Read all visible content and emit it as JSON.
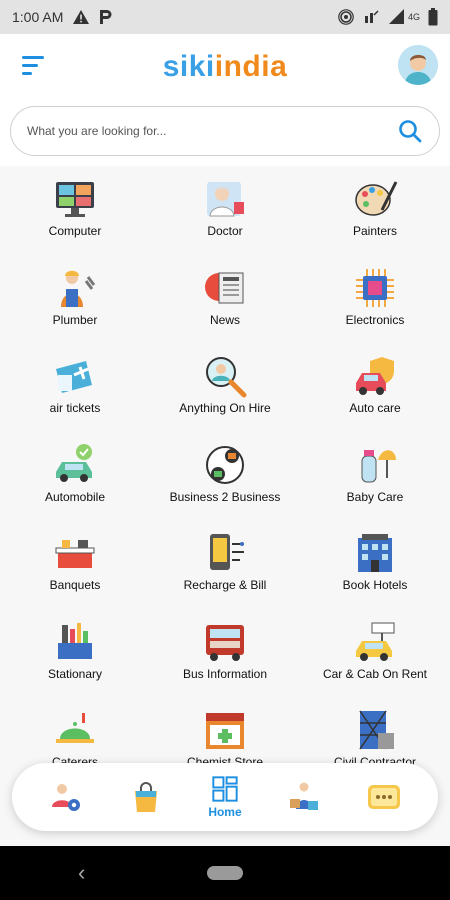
{
  "status_bar": {
    "time": "1:00 AM",
    "notification_icons": [
      "warning-icon",
      "parking-icon"
    ],
    "system_icons": [
      "hotspot-icon",
      "data-saver-icon",
      "signal-icon",
      "lte-icon",
      "battery-icon"
    ],
    "network_label": "4G"
  },
  "header": {
    "logo_part1": "siki",
    "logo_part2": "india",
    "logo_color1": "#3aa0e6",
    "logo_color2": "#f08a1c",
    "menu_icon": "menu-icon",
    "avatar_icon": "user-avatar-icon"
  },
  "search": {
    "placeholder": "What you are looking for...",
    "icon": "search-icon",
    "accent": "#1e8fe0"
  },
  "categories": [
    {
      "label": "Computer",
      "icon": "computer-icon"
    },
    {
      "label": "Doctor",
      "icon": "doctor-icon"
    },
    {
      "label": "Painters",
      "icon": "palette-icon"
    },
    {
      "label": "Plumber",
      "icon": "plumber-icon"
    },
    {
      "label": "News",
      "icon": "newspaper-icon"
    },
    {
      "label": "Electronics",
      "icon": "chip-icon"
    },
    {
      "label": "air tickets",
      "icon": "airplane-ticket-icon"
    },
    {
      "label": "Anything On Hire",
      "icon": "magnifier-person-icon"
    },
    {
      "label": "Auto care",
      "icon": "car-shield-icon"
    },
    {
      "label": "Automobile",
      "icon": "car-check-icon"
    },
    {
      "label": "Business 2 Business",
      "icon": "b2b-exchange-icon"
    },
    {
      "label": "Baby Care",
      "icon": "baby-bottle-icon"
    },
    {
      "label": "Banquets",
      "icon": "banquet-table-icon"
    },
    {
      "label": "Recharge & Bill",
      "icon": "phone-bill-icon"
    },
    {
      "label": "Book Hotels",
      "icon": "hotel-building-icon"
    },
    {
      "label": "Stationary",
      "icon": "stationery-icon"
    },
    {
      "label": "Bus Information",
      "icon": "bus-icon"
    },
    {
      "label": "Car & Cab On Rent",
      "icon": "taxi-icon"
    },
    {
      "label": "Caterers",
      "icon": "cloche-icon"
    },
    {
      "label": "Chemist Store",
      "icon": "pharmacy-store-icon"
    },
    {
      "label": "Civil Contractor",
      "icon": "construction-building-icon"
    }
  ],
  "bottom_nav": {
    "items": [
      {
        "icon": "users-settings-icon",
        "label": ""
      },
      {
        "icon": "shopping-bag-icon",
        "label": ""
      },
      {
        "icon": "home-grid-icon",
        "label": "Home"
      },
      {
        "icon": "delivery-person-icon",
        "label": ""
      },
      {
        "icon": "chat-bubble-icon",
        "label": ""
      }
    ],
    "active": "Home",
    "active_color": "#1e8fe0"
  },
  "system_nav": {
    "back_icon": "back-chevron-icon",
    "home_icon": "home-pill-icon"
  }
}
